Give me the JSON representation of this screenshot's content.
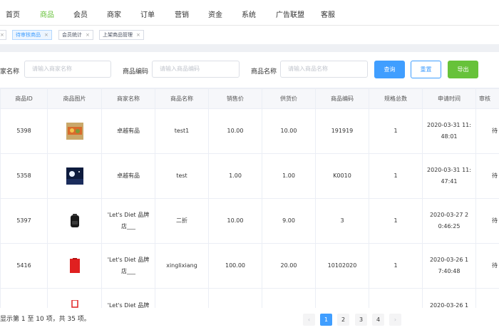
{
  "nav": {
    "items": [
      "首页",
      "商品",
      "会员",
      "商家",
      "订单",
      "营销",
      "资金",
      "系统",
      "广告联盟",
      "客服"
    ],
    "active_index": 1
  },
  "tags": [
    {
      "label": "待审核商品",
      "active": true
    },
    {
      "label": "会员统计",
      "active": false
    },
    {
      "label": "上架商品管理",
      "active": false
    }
  ],
  "filters": {
    "merchant_label": "家名称",
    "merchant_placeholder": "请输入商家名称",
    "code_label": "商品编码",
    "code_placeholder": "请输入商品编码",
    "name_label": "商品名称",
    "name_placeholder": "请输入商品名称"
  },
  "buttons": {
    "query": "查询",
    "reset": "重置",
    "export": "导出"
  },
  "table": {
    "headers": [
      "商品ID",
      "商品图片",
      "商家名称",
      "商品名称",
      "销售价",
      "供货价",
      "商品编码",
      "规格总数",
      "申请时间",
      "审核"
    ],
    "rows": [
      {
        "id": "5398",
        "merchant": "卓越有品",
        "name": "test1",
        "price": "10.00",
        "supply": "10.00",
        "code": "191919",
        "specs": "1",
        "time_1": "2020-03-31 11:",
        "time_2": "48:01",
        "status": "待",
        "image": "food-image"
      },
      {
        "id": "5358",
        "merchant": "卓越有品",
        "name": "test",
        "price": "1.00",
        "supply": "1.00",
        "code": "K0010",
        "specs": "1",
        "time_1": "2020-03-31 11:",
        "time_2": "47:41",
        "status": "待",
        "image": "night-scene-image"
      },
      {
        "id": "5397",
        "merchant_1": "'Let's Diet 品牌",
        "merchant_2": "店___",
        "name": "二折",
        "price": "10.00",
        "supply": "9.00",
        "code": "3",
        "specs": "1",
        "time_1": "2020-03-27 2",
        "time_2": "0:46:25",
        "status": "待",
        "image": "backpack-image"
      },
      {
        "id": "5416",
        "merchant_1": "'Let's Diet 品牌",
        "merchant_2": "店___",
        "name": "xinglixiang",
        "price": "100.00",
        "supply": "20.00",
        "code": "10102020",
        "specs": "1",
        "time_1": "2020-03-26 1",
        "time_2": "7:40:48",
        "status": "待",
        "image": "red-box-image"
      },
      {
        "merchant_1": "'Let's Diet 品牌",
        "time_1": "2020-03-26 1"
      }
    ]
  },
  "pagination": {
    "summary": "显示第 1 至 10 项，共 35 项。",
    "prev": "‹",
    "pages": [
      "1",
      "2",
      "3",
      "4"
    ],
    "next": "›",
    "active_page": "1"
  },
  "colors": {
    "primary": "#409eff",
    "success": "#67c23a",
    "active_nav": "#67c23a"
  }
}
